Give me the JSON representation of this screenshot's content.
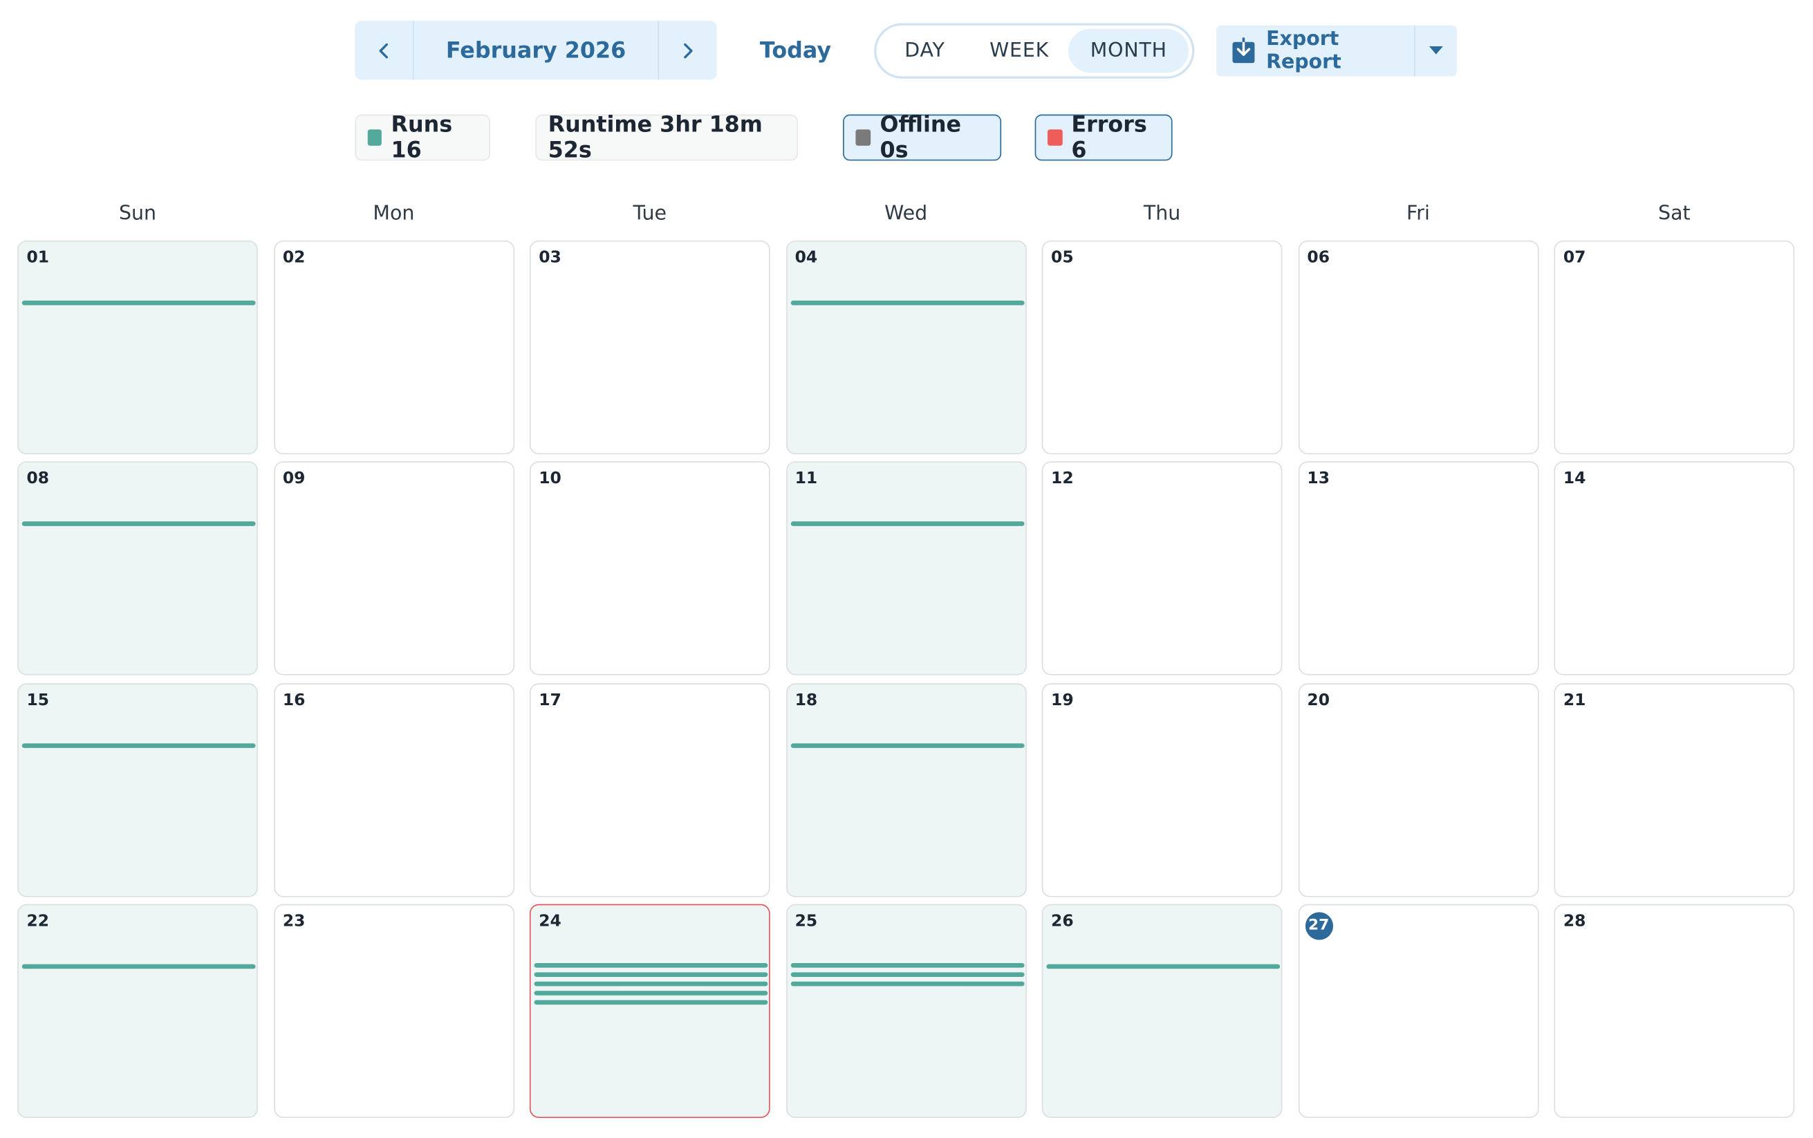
{
  "nav": {
    "month_label": "February 2026",
    "today_label": "Today",
    "views": [
      "DAY",
      "WEEK",
      "MONTH"
    ],
    "active_view": "MONTH",
    "export_label": "Export Report"
  },
  "stats": {
    "runs": {
      "label": "Runs",
      "value": "16",
      "text": "Runs 16",
      "color": "#52a89b"
    },
    "runtime": {
      "label": "Runtime",
      "value": "3hr 18m 52s",
      "text": "Runtime 3hr 18m 52s"
    },
    "offline": {
      "label": "Offline",
      "value": "0s",
      "text": "Offline 0s",
      "color": "#7a7a7a"
    },
    "errors": {
      "label": "Errors",
      "value": "6",
      "text": "Errors 6",
      "color": "#ee5d5a"
    }
  },
  "weekdays": [
    "Sun",
    "Mon",
    "Tue",
    "Wed",
    "Thu",
    "Fri",
    "Sat"
  ],
  "colors": {
    "accent": "#2c6a9c",
    "run_bar": "#52a89b",
    "run_day_bg": "#eef6f5",
    "error_border": "#e0595c"
  },
  "days": [
    {
      "label": "01",
      "runs": 1
    },
    {
      "label": "02",
      "runs": 0
    },
    {
      "label": "03",
      "runs": 0
    },
    {
      "label": "04",
      "runs": 1
    },
    {
      "label": "05",
      "runs": 0
    },
    {
      "label": "06",
      "runs": 0
    },
    {
      "label": "07",
      "runs": 0
    },
    {
      "label": "08",
      "runs": 1
    },
    {
      "label": "09",
      "runs": 0
    },
    {
      "label": "10",
      "runs": 0
    },
    {
      "label": "11",
      "runs": 1
    },
    {
      "label": "12",
      "runs": 0
    },
    {
      "label": "13",
      "runs": 0
    },
    {
      "label": "14",
      "runs": 0
    },
    {
      "label": "15",
      "runs": 1
    },
    {
      "label": "16",
      "runs": 0
    },
    {
      "label": "17",
      "runs": 0
    },
    {
      "label": "18",
      "runs": 1
    },
    {
      "label": "19",
      "runs": 0
    },
    {
      "label": "20",
      "runs": 0
    },
    {
      "label": "21",
      "runs": 0
    },
    {
      "label": "22",
      "runs": 1
    },
    {
      "label": "23",
      "runs": 0
    },
    {
      "label": "24",
      "runs": 5,
      "error": true
    },
    {
      "label": "25",
      "runs": 3
    },
    {
      "label": "26",
      "runs": 1
    },
    {
      "label": "27",
      "runs": 0,
      "today": true
    },
    {
      "label": "28",
      "runs": 0
    }
  ]
}
